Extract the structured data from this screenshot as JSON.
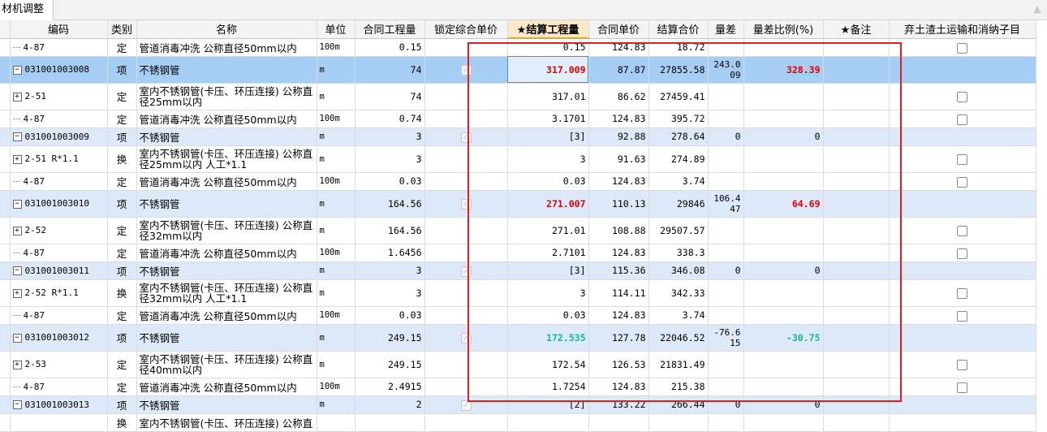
{
  "tab_label": "材机调整",
  "icons": {
    "scroll_up": "arrow-up-icon",
    "expand": "plus-icon",
    "collapse": "minus-icon"
  },
  "colors": {
    "selected_row": "#a6cdf3",
    "item_row": "#dde9f8",
    "increase": "#e00000",
    "decrease": "#14b98a",
    "highlight_box": "#e51c1c"
  },
  "columns": {
    "code": "编码",
    "type": "类别",
    "name": "名称",
    "unit": "单位",
    "contract_qty": "合同工程量",
    "lock_price": "锁定综合单价",
    "settle_qty": "★结算工程量",
    "contract_price": "合同单价",
    "settle_total": "结算合价",
    "qty_diff": "量差",
    "diff_ratio": "量差比例(%)",
    "remark": "★备注",
    "earthwork": "弃土渣土运输和消纳子目"
  },
  "rows": [
    {
      "code": "4-87",
      "type": "定",
      "name": "管道消毒冲洗 公称直径50mm以内",
      "unit": "100m",
      "contract_qty": "0.15",
      "settle_qty": "0.15",
      "contract_price": "124.83",
      "settle_total": "18.72",
      "qty_diff": "",
      "diff_ratio": ""
    },
    {
      "code": "031001003008",
      "type": "项",
      "name": "不锈钢管",
      "unit": "m",
      "contract_qty": "74",
      "settle_qty": "317.009",
      "contract_price": "87.87",
      "settle_total": "27855.58",
      "qty_diff": "243.009",
      "diff_ratio": "328.39"
    },
    {
      "code": "2-51",
      "type": "定",
      "name": "室内不锈钢管(卡压、环压连接) 公称直径25mm以内",
      "unit": "m",
      "contract_qty": "74",
      "settle_qty": "317.01",
      "contract_price": "86.62",
      "settle_total": "27459.41",
      "qty_diff": "",
      "diff_ratio": ""
    },
    {
      "code": "4-87",
      "type": "定",
      "name": "管道消毒冲洗 公称直径50mm以内",
      "unit": "100m",
      "contract_qty": "0.74",
      "settle_qty": "3.1701",
      "contract_price": "124.83",
      "settle_total": "395.72",
      "qty_diff": "",
      "diff_ratio": ""
    },
    {
      "code": "031001003009",
      "type": "项",
      "name": "不锈钢管",
      "unit": "m",
      "contract_qty": "3",
      "settle_qty": "[3]",
      "contract_price": "92.88",
      "settle_total": "278.64",
      "qty_diff": "0",
      "diff_ratio": "0"
    },
    {
      "code": "2-51 R*1.1",
      "type": "换",
      "name": "室内不锈钢管(卡压、环压连接) 公称直径25mm以内 人工*1.1",
      "unit": "m",
      "contract_qty": "3",
      "settle_qty": "3",
      "contract_price": "91.63",
      "settle_total": "274.89",
      "qty_diff": "",
      "diff_ratio": ""
    },
    {
      "code": "4-87",
      "type": "定",
      "name": "管道消毒冲洗 公称直径50mm以内",
      "unit": "100m",
      "contract_qty": "0.03",
      "settle_qty": "0.03",
      "contract_price": "124.83",
      "settle_total": "3.74",
      "qty_diff": "",
      "diff_ratio": ""
    },
    {
      "code": "031001003010",
      "type": "项",
      "name": "不锈钢管",
      "unit": "m",
      "contract_qty": "164.56",
      "settle_qty": "271.007",
      "contract_price": "110.13",
      "settle_total": "29846",
      "qty_diff": "106.447",
      "diff_ratio": "64.69"
    },
    {
      "code": "2-52",
      "type": "定",
      "name": "室内不锈钢管(卡压、环压连接) 公称直径32mm以内",
      "unit": "m",
      "contract_qty": "164.56",
      "settle_qty": "271.01",
      "contract_price": "108.88",
      "settle_total": "29507.57",
      "qty_diff": "",
      "diff_ratio": ""
    },
    {
      "code": "4-87",
      "type": "定",
      "name": "管道消毒冲洗 公称直径50mm以内",
      "unit": "100m",
      "contract_qty": "1.6456",
      "settle_qty": "2.7101",
      "contract_price": "124.83",
      "settle_total": "338.3",
      "qty_diff": "",
      "diff_ratio": ""
    },
    {
      "code": "031001003011",
      "type": "项",
      "name": "不锈钢管",
      "unit": "m",
      "contract_qty": "3",
      "settle_qty": "[3]",
      "contract_price": "115.36",
      "settle_total": "346.08",
      "qty_diff": "0",
      "diff_ratio": "0"
    },
    {
      "code": "2-52 R*1.1",
      "type": "换",
      "name": "室内不锈钢管(卡压、环压连接) 公称直径32mm以内 人工*1.1",
      "unit": "m",
      "contract_qty": "3",
      "settle_qty": "3",
      "contract_price": "114.11",
      "settle_total": "342.33",
      "qty_diff": "",
      "diff_ratio": ""
    },
    {
      "code": "4-87",
      "type": "定",
      "name": "管道消毒冲洗 公称直径50mm以内",
      "unit": "100m",
      "contract_qty": "0.03",
      "settle_qty": "0.03",
      "contract_price": "124.83",
      "settle_total": "3.74",
      "qty_diff": "",
      "diff_ratio": ""
    },
    {
      "code": "031001003012",
      "type": "项",
      "name": "不锈钢管",
      "unit": "m",
      "contract_qty": "249.15",
      "settle_qty": "172.535",
      "contract_price": "127.78",
      "settle_total": "22046.52",
      "qty_diff": "-76.615",
      "diff_ratio": "-30.75"
    },
    {
      "code": "2-53",
      "type": "定",
      "name": "室内不锈钢管(卡压、环压连接) 公称直径40mm以内",
      "unit": "m",
      "contract_qty": "249.15",
      "settle_qty": "172.54",
      "contract_price": "126.53",
      "settle_total": "21831.49",
      "qty_diff": "",
      "diff_ratio": ""
    },
    {
      "code": "4-87",
      "type": "定",
      "name": "管道消毒冲洗 公称直径50mm以内",
      "unit": "100m",
      "contract_qty": "2.4915",
      "settle_qty": "1.7254",
      "contract_price": "124.83",
      "settle_total": "215.38",
      "qty_diff": "",
      "diff_ratio": ""
    },
    {
      "code": "031001003013",
      "type": "项",
      "name": "不锈钢管",
      "unit": "m",
      "contract_qty": "2",
      "settle_qty": "[2]",
      "contract_price": "133.22",
      "settle_total": "266.44",
      "qty_diff": "0",
      "diff_ratio": "0"
    },
    {
      "code": "",
      "type": "换",
      "name": "室内不锈钢管(卡压、环压连接) 公称直",
      "unit": "",
      "contract_qty": "",
      "settle_qty": "",
      "contract_price": "",
      "settle_total": "",
      "qty_diff": "",
      "diff_ratio": ""
    }
  ]
}
